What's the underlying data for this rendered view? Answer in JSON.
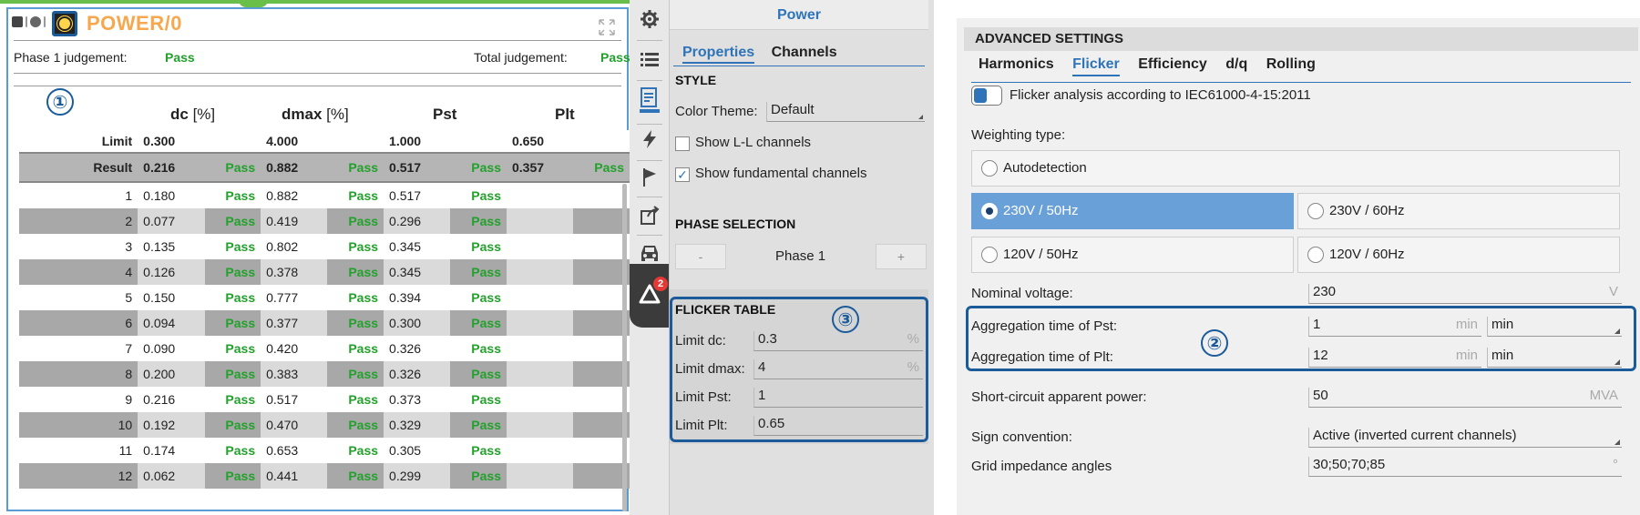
{
  "widget": {
    "title": "POWER/0",
    "phase_label": "Phase 1 judgement:",
    "phase_value": "Pass",
    "total_label": "Total judgement:",
    "total_value": "Pass",
    "marker": "①",
    "columns": [
      {
        "name": "dc",
        "unit": "[%]"
      },
      {
        "name": "dmax",
        "unit": "[%]"
      },
      {
        "name": "Pst",
        "unit": ""
      },
      {
        "name": "Plt",
        "unit": ""
      }
    ],
    "limit": {
      "label": "Limit",
      "dc": "0.300",
      "dmax": "4.000",
      "pst": "1.000",
      "plt": "0.650"
    },
    "result": {
      "label": "Result",
      "dc": "0.216",
      "dc_j": "Pass",
      "dmax": "0.882",
      "dmax_j": "Pass",
      "pst": "0.517",
      "pst_j": "Pass",
      "plt": "0.357",
      "plt_j": "Pass"
    },
    "rows": [
      {
        "n": "1",
        "dc": "0.180",
        "dc_j": "Pass",
        "dmax": "0.882",
        "dmax_j": "Pass",
        "pst": "0.517",
        "pst_j": "Pass"
      },
      {
        "n": "2",
        "dc": "0.077",
        "dc_j": "Pass",
        "dmax": "0.419",
        "dmax_j": "Pass",
        "pst": "0.296",
        "pst_j": "Pass"
      },
      {
        "n": "3",
        "dc": "0.135",
        "dc_j": "Pass",
        "dmax": "0.802",
        "dmax_j": "Pass",
        "pst": "0.345",
        "pst_j": "Pass"
      },
      {
        "n": "4",
        "dc": "0.126",
        "dc_j": "Pass",
        "dmax": "0.378",
        "dmax_j": "Pass",
        "pst": "0.345",
        "pst_j": "Pass"
      },
      {
        "n": "5",
        "dc": "0.150",
        "dc_j": "Pass",
        "dmax": "0.777",
        "dmax_j": "Pass",
        "pst": "0.394",
        "pst_j": "Pass"
      },
      {
        "n": "6",
        "dc": "0.094",
        "dc_j": "Pass",
        "dmax": "0.377",
        "dmax_j": "Pass",
        "pst": "0.300",
        "pst_j": "Pass"
      },
      {
        "n": "7",
        "dc": "0.090",
        "dc_j": "Pass",
        "dmax": "0.420",
        "dmax_j": "Pass",
        "pst": "0.326",
        "pst_j": "Pass"
      },
      {
        "n": "8",
        "dc": "0.200",
        "dc_j": "Pass",
        "dmax": "0.383",
        "dmax_j": "Pass",
        "pst": "0.326",
        "pst_j": "Pass"
      },
      {
        "n": "9",
        "dc": "0.216",
        "dc_j": "Pass",
        "dmax": "0.517",
        "dmax_j": "Pass",
        "pst": "0.373",
        "pst_j": "Pass"
      },
      {
        "n": "10",
        "dc": "0.192",
        "dc_j": "Pass",
        "dmax": "0.470",
        "dmax_j": "Pass",
        "pst": "0.329",
        "pst_j": "Pass"
      },
      {
        "n": "11",
        "dc": "0.174",
        "dc_j": "Pass",
        "dmax": "0.653",
        "dmax_j": "Pass",
        "pst": "0.305",
        "pst_j": "Pass"
      },
      {
        "n": "12",
        "dc": "0.062",
        "dc_j": "Pass",
        "dmax": "0.441",
        "dmax_j": "Pass",
        "pst": "0.299",
        "pst_j": "Pass"
      }
    ]
  },
  "toolbar": {
    "icons": [
      "gear-icon",
      "list-icon",
      "properties-icon",
      "lightning-icon",
      "flag-icon",
      "export-icon",
      "car-icon",
      "warning-icon"
    ],
    "badge": "2"
  },
  "middle": {
    "title": "Power",
    "tabs": [
      "Properties",
      "Channels"
    ],
    "style_header": "STYLE",
    "color_theme_label": "Color Theme:",
    "color_theme_value": "Default",
    "show_ll_label": "Show L-L channels",
    "show_fund_label": "Show fundamental channels",
    "phase_header": "PHASE SELECTION",
    "minus": "-",
    "phase_value": "Phase 1",
    "plus": "+",
    "flicker_header": "FLICKER TABLE",
    "marker": "③",
    "limits": [
      {
        "label": "Limit dc:",
        "value": "0.3",
        "unit": "%"
      },
      {
        "label": "Limit dmax:",
        "value": "4",
        "unit": "%"
      },
      {
        "label": "Limit Pst:",
        "value": "1",
        "unit": ""
      },
      {
        "label": "Limit Plt:",
        "value": "0.65",
        "unit": ""
      }
    ]
  },
  "right": {
    "header": "ADVANCED SETTINGS",
    "tabs": [
      "Harmonics",
      "Flicker",
      "Efficiency",
      "d/q",
      "Rolling"
    ],
    "flicker_toggle_label": "Flicker analysis according to IEC61000-4-15:2011",
    "weighting_label": "Weighting type:",
    "opt_auto": "Autodetection",
    "opt_230_50": "230V / 50Hz",
    "opt_230_60": "230V / 60Hz",
    "opt_120_50": "120V / 50Hz",
    "opt_120_60": "120V / 60Hz",
    "nominal_label": "Nominal voltage:",
    "nominal_value": "230",
    "nominal_unit": "V",
    "marker": "②",
    "pst_label": "Aggregation time of Pst:",
    "pst_value": "1",
    "pst_unit": "min",
    "pst_select": "min",
    "plt_label": "Aggregation time of Plt:",
    "plt_value": "12",
    "plt_unit": "min",
    "plt_select": "min",
    "sc_label": "Short-circuit apparent power:",
    "sc_value": "50",
    "sc_unit": "MVA",
    "sign_label": "Sign convention:",
    "sign_value": "Active (inverted current channels)",
    "grid_label": "Grid impedance angles",
    "grid_value": "30;50;70;85",
    "grid_unit": "°"
  }
}
